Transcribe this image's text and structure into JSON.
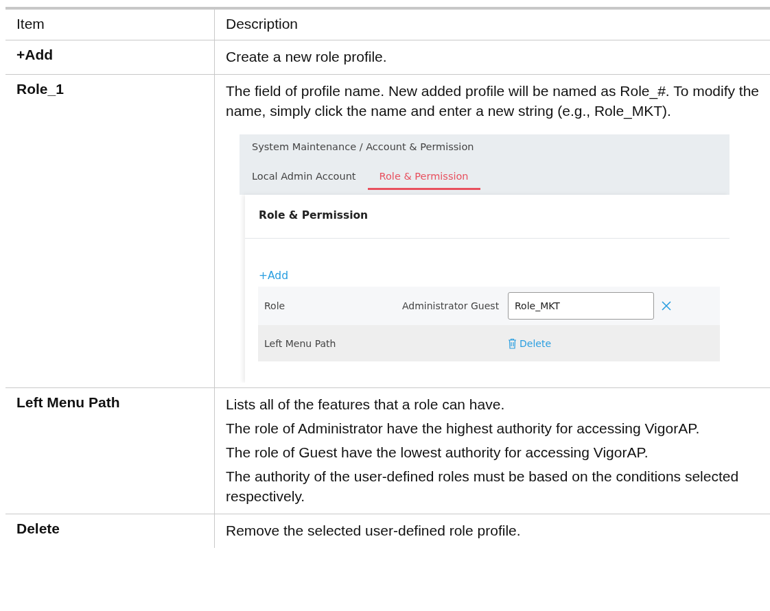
{
  "table": {
    "columns": [
      "Item",
      "Description"
    ],
    "rows": [
      {
        "item": "+Add",
        "paragraphs": [
          "Create a new role profile."
        ]
      },
      {
        "item": "Role_1",
        "paragraphs": [
          "The field of profile name. New added profile will be named as Role_#. To modify the name, simply click the name and enter a new string (e.g., Role_MKT)."
        ],
        "screenshot": {
          "breadcrumb": "System Maintenance / Account & Permission",
          "tabs": [
            {
              "label": "Local Admin Account",
              "selected": false
            },
            {
              "label": "Role & Permission",
              "selected": true
            }
          ],
          "card_title": "Role & Permission",
          "add_link": "+Add",
          "role_row": {
            "label": "Role",
            "columns": [
              "Administrator",
              "Guest"
            ],
            "name_field": {
              "value": "Role_MKT"
            }
          },
          "menu_row": {
            "label": "Left Menu Path",
            "delete_link": "Delete"
          }
        }
      },
      {
        "item": "Left Menu Path",
        "paragraphs": [
          "Lists all of the features that a role can have.",
          "The role of Administrator have the highest authority for accessing VigorAP.",
          "The role of Guest have the lowest authority for accessing VigorAP.",
          "The authority of the user-defined roles must be based on the conditions selected respectively."
        ]
      },
      {
        "item": "Delete",
        "paragraphs": [
          "Remove the selected user-defined role profile."
        ]
      }
    ]
  }
}
